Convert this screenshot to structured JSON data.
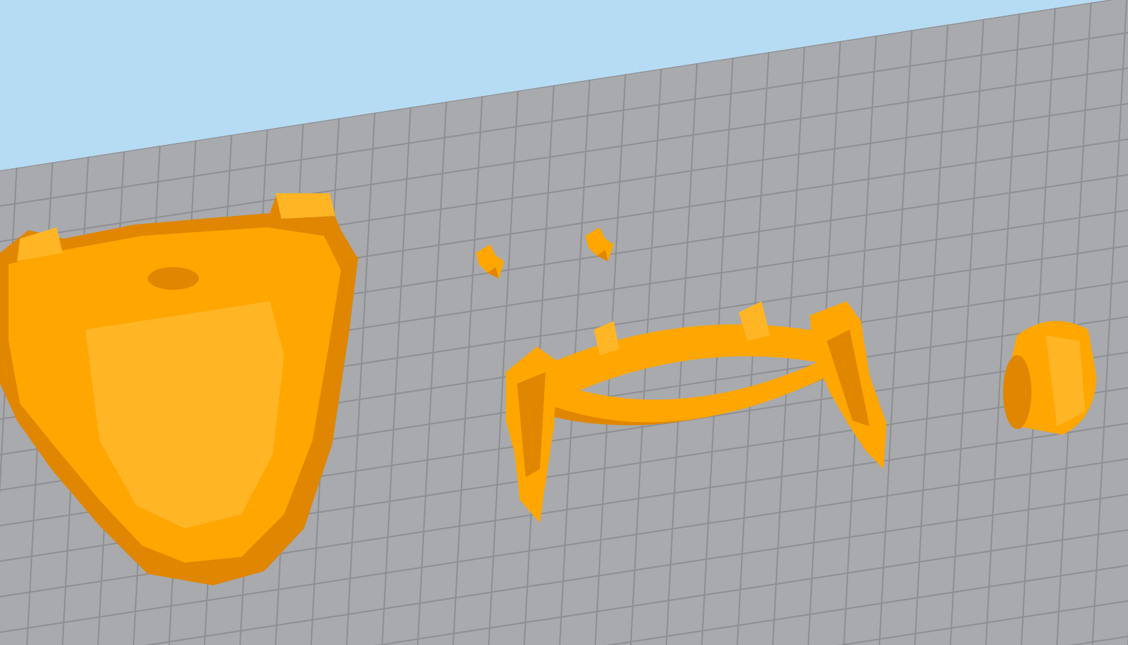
{
  "scene": {
    "kind": "build-plate",
    "models": [
      {
        "kind": "chest-plate"
      },
      {
        "kind": "clip"
      },
      {
        "kind": "clip"
      },
      {
        "kind": "belt"
      },
      {
        "kind": "cuff"
      }
    ]
  }
}
